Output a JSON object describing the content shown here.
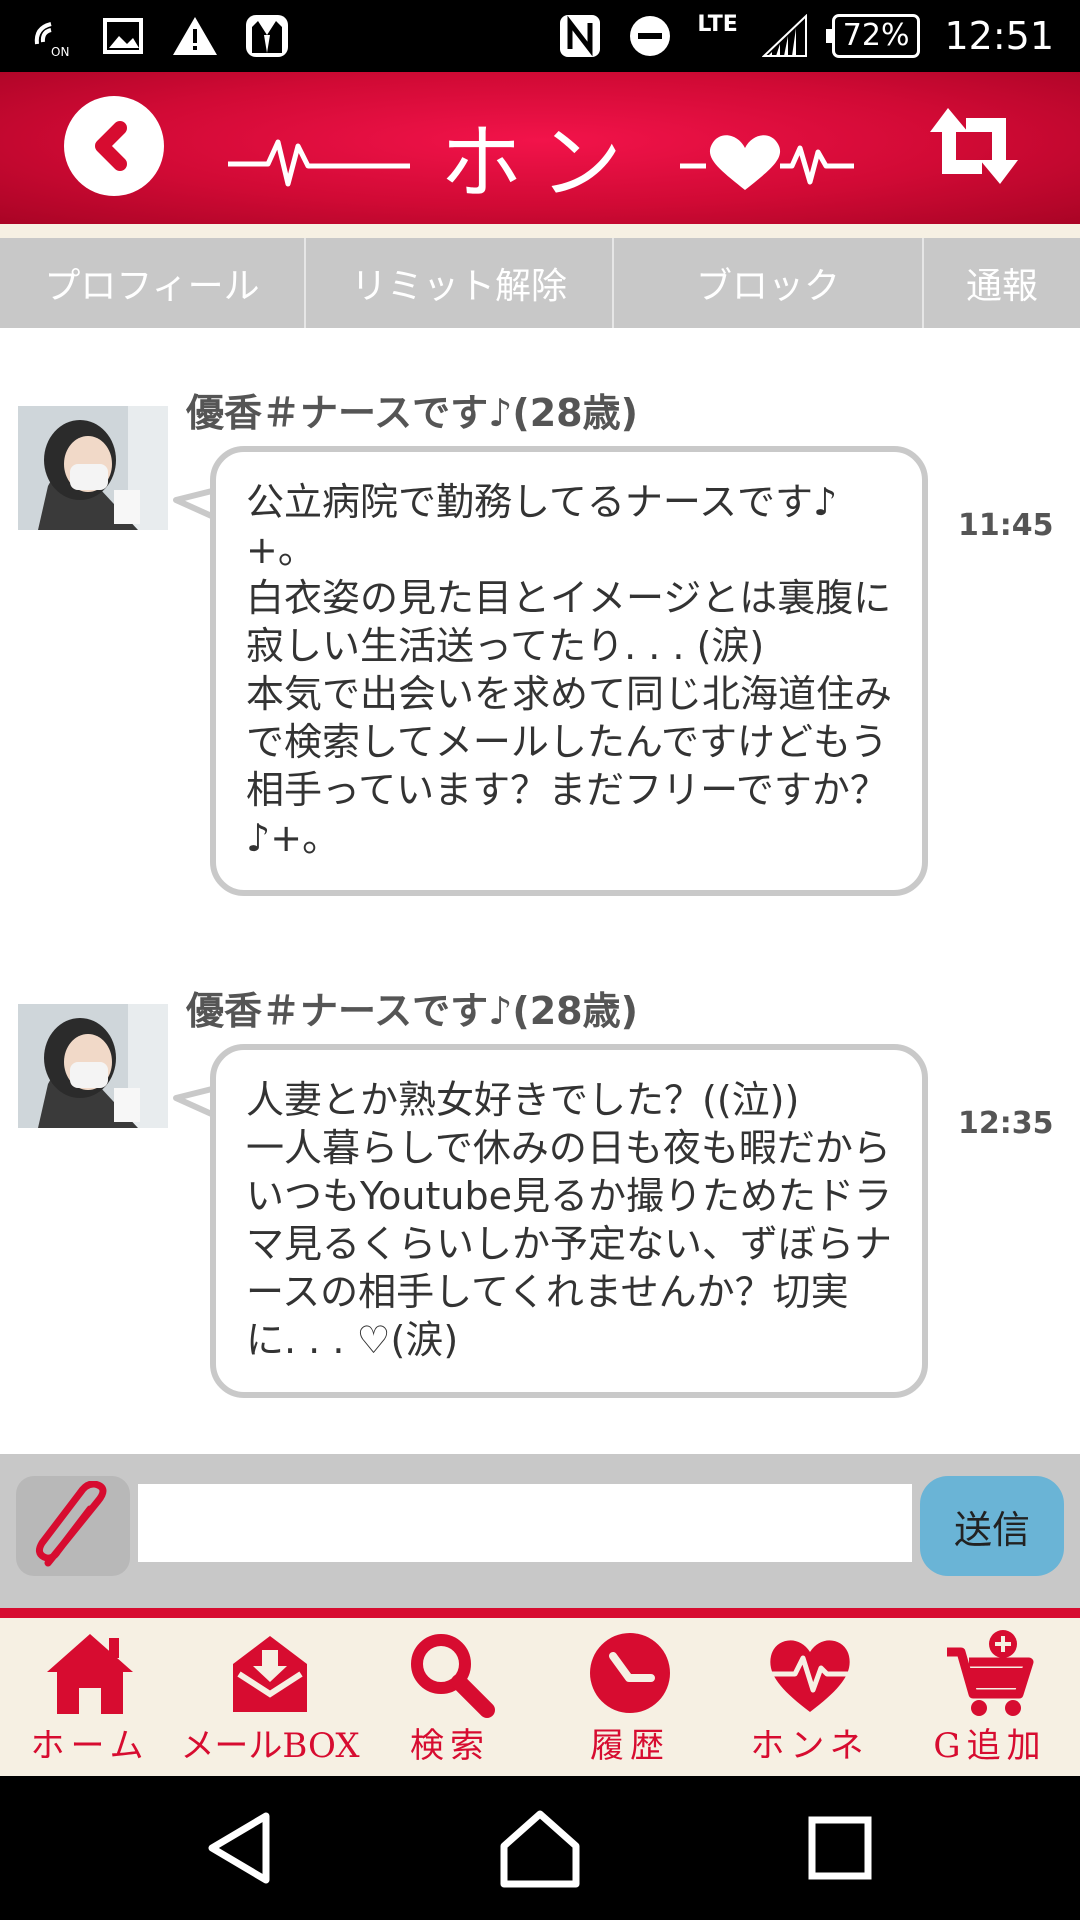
{
  "status_bar": {
    "network": "LTE",
    "battery": "72%",
    "time": "12:51",
    "icons": [
      "wifi-calling-icon",
      "image-icon",
      "warning-icon",
      "tuxedo-icon",
      "nfc-icon",
      "do-not-disturb-icon",
      "signal-icon",
      "battery-icon"
    ]
  },
  "header": {
    "title": "ホンネ",
    "back_icon": "back-chevron-icon",
    "refresh_icon": "refresh-arrows-icon",
    "brand_color": "#d70c30"
  },
  "action_tabs": [
    {
      "label": "プロフィール"
    },
    {
      "label": "リミット解除"
    },
    {
      "label": "ブロック"
    },
    {
      "label": "通報"
    }
  ],
  "messages": [
    {
      "sender": "優香＃ナースです♪(28歳)",
      "time": "11:45",
      "text": "公立病院で勤務してるナースです♪+。\n白衣姿の見た目とイメージとは裏腹に寂しい生活送ってたり. . . (涙)\n本気で出会いを求めて同じ北海道住みで検索してメールしたんですけどもう相手っています？まだフリーですか？♪+。"
    },
    {
      "sender": "優香＃ナースです♪(28歳)",
      "time": "12:35",
      "text": "人妻とか熟女好きでした？((泣))\n一人暮らしで休みの日も夜も暇だからいつもYoutube見るか撮りためたドラマ見るくらいしか予定ない、ずぼらナースの相手してくれませんか？切実に. . . ♡(涙)"
    }
  ],
  "composer": {
    "input_value": "",
    "send_label": "送信",
    "attach_icon": "paperclip-icon",
    "send_color": "#6ab4d6"
  },
  "bottom_nav": [
    {
      "label": "ホーム",
      "icon": "home-icon"
    },
    {
      "label": "メールBOX",
      "icon": "mailbox-icon"
    },
    {
      "label": "検索",
      "icon": "search-icon"
    },
    {
      "label": "履歴",
      "icon": "history-clock-icon"
    },
    {
      "label": "ホンネ",
      "icon": "heart-pulse-icon"
    },
    {
      "label": "G追加",
      "icon": "cart-add-icon"
    }
  ],
  "system_nav": [
    "back-triangle-icon",
    "home-outline-icon",
    "recents-square-icon"
  ]
}
